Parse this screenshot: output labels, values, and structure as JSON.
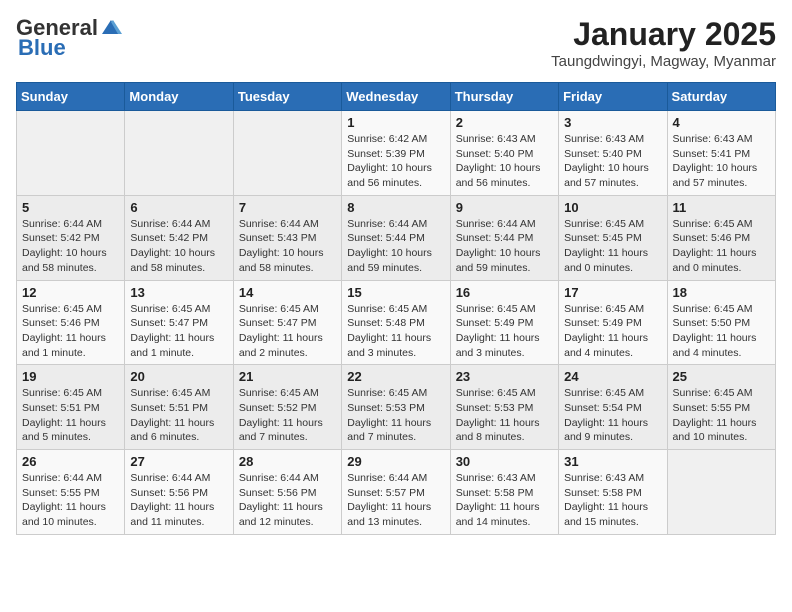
{
  "logo": {
    "general": "General",
    "blue": "Blue"
  },
  "header": {
    "month": "January 2025",
    "location": "Taungdwingyi, Magway, Myanmar"
  },
  "weekdays": [
    "Sunday",
    "Monday",
    "Tuesday",
    "Wednesday",
    "Thursday",
    "Friday",
    "Saturday"
  ],
  "weeks": [
    [
      {
        "day": "",
        "info": ""
      },
      {
        "day": "",
        "info": ""
      },
      {
        "day": "",
        "info": ""
      },
      {
        "day": "1",
        "info": "Sunrise: 6:42 AM\nSunset: 5:39 PM\nDaylight: 10 hours and 56 minutes."
      },
      {
        "day": "2",
        "info": "Sunrise: 6:43 AM\nSunset: 5:40 PM\nDaylight: 10 hours and 56 minutes."
      },
      {
        "day": "3",
        "info": "Sunrise: 6:43 AM\nSunset: 5:40 PM\nDaylight: 10 hours and 57 minutes."
      },
      {
        "day": "4",
        "info": "Sunrise: 6:43 AM\nSunset: 5:41 PM\nDaylight: 10 hours and 57 minutes."
      }
    ],
    [
      {
        "day": "5",
        "info": "Sunrise: 6:44 AM\nSunset: 5:42 PM\nDaylight: 10 hours and 58 minutes."
      },
      {
        "day": "6",
        "info": "Sunrise: 6:44 AM\nSunset: 5:42 PM\nDaylight: 10 hours and 58 minutes."
      },
      {
        "day": "7",
        "info": "Sunrise: 6:44 AM\nSunset: 5:43 PM\nDaylight: 10 hours and 58 minutes."
      },
      {
        "day": "8",
        "info": "Sunrise: 6:44 AM\nSunset: 5:44 PM\nDaylight: 10 hours and 59 minutes."
      },
      {
        "day": "9",
        "info": "Sunrise: 6:44 AM\nSunset: 5:44 PM\nDaylight: 10 hours and 59 minutes."
      },
      {
        "day": "10",
        "info": "Sunrise: 6:45 AM\nSunset: 5:45 PM\nDaylight: 11 hours and 0 minutes."
      },
      {
        "day": "11",
        "info": "Sunrise: 6:45 AM\nSunset: 5:46 PM\nDaylight: 11 hours and 0 minutes."
      }
    ],
    [
      {
        "day": "12",
        "info": "Sunrise: 6:45 AM\nSunset: 5:46 PM\nDaylight: 11 hours and 1 minute."
      },
      {
        "day": "13",
        "info": "Sunrise: 6:45 AM\nSunset: 5:47 PM\nDaylight: 11 hours and 1 minute."
      },
      {
        "day": "14",
        "info": "Sunrise: 6:45 AM\nSunset: 5:47 PM\nDaylight: 11 hours and 2 minutes."
      },
      {
        "day": "15",
        "info": "Sunrise: 6:45 AM\nSunset: 5:48 PM\nDaylight: 11 hours and 3 minutes."
      },
      {
        "day": "16",
        "info": "Sunrise: 6:45 AM\nSunset: 5:49 PM\nDaylight: 11 hours and 3 minutes."
      },
      {
        "day": "17",
        "info": "Sunrise: 6:45 AM\nSunset: 5:49 PM\nDaylight: 11 hours and 4 minutes."
      },
      {
        "day": "18",
        "info": "Sunrise: 6:45 AM\nSunset: 5:50 PM\nDaylight: 11 hours and 4 minutes."
      }
    ],
    [
      {
        "day": "19",
        "info": "Sunrise: 6:45 AM\nSunset: 5:51 PM\nDaylight: 11 hours and 5 minutes."
      },
      {
        "day": "20",
        "info": "Sunrise: 6:45 AM\nSunset: 5:51 PM\nDaylight: 11 hours and 6 minutes."
      },
      {
        "day": "21",
        "info": "Sunrise: 6:45 AM\nSunset: 5:52 PM\nDaylight: 11 hours and 7 minutes."
      },
      {
        "day": "22",
        "info": "Sunrise: 6:45 AM\nSunset: 5:53 PM\nDaylight: 11 hours and 7 minutes."
      },
      {
        "day": "23",
        "info": "Sunrise: 6:45 AM\nSunset: 5:53 PM\nDaylight: 11 hours and 8 minutes."
      },
      {
        "day": "24",
        "info": "Sunrise: 6:45 AM\nSunset: 5:54 PM\nDaylight: 11 hours and 9 minutes."
      },
      {
        "day": "25",
        "info": "Sunrise: 6:45 AM\nSunset: 5:55 PM\nDaylight: 11 hours and 10 minutes."
      }
    ],
    [
      {
        "day": "26",
        "info": "Sunrise: 6:44 AM\nSunset: 5:55 PM\nDaylight: 11 hours and 10 minutes."
      },
      {
        "day": "27",
        "info": "Sunrise: 6:44 AM\nSunset: 5:56 PM\nDaylight: 11 hours and 11 minutes."
      },
      {
        "day": "28",
        "info": "Sunrise: 6:44 AM\nSunset: 5:56 PM\nDaylight: 11 hours and 12 minutes."
      },
      {
        "day": "29",
        "info": "Sunrise: 6:44 AM\nSunset: 5:57 PM\nDaylight: 11 hours and 13 minutes."
      },
      {
        "day": "30",
        "info": "Sunrise: 6:43 AM\nSunset: 5:58 PM\nDaylight: 11 hours and 14 minutes."
      },
      {
        "day": "31",
        "info": "Sunrise: 6:43 AM\nSunset: 5:58 PM\nDaylight: 11 hours and 15 minutes."
      },
      {
        "day": "",
        "info": ""
      }
    ]
  ]
}
